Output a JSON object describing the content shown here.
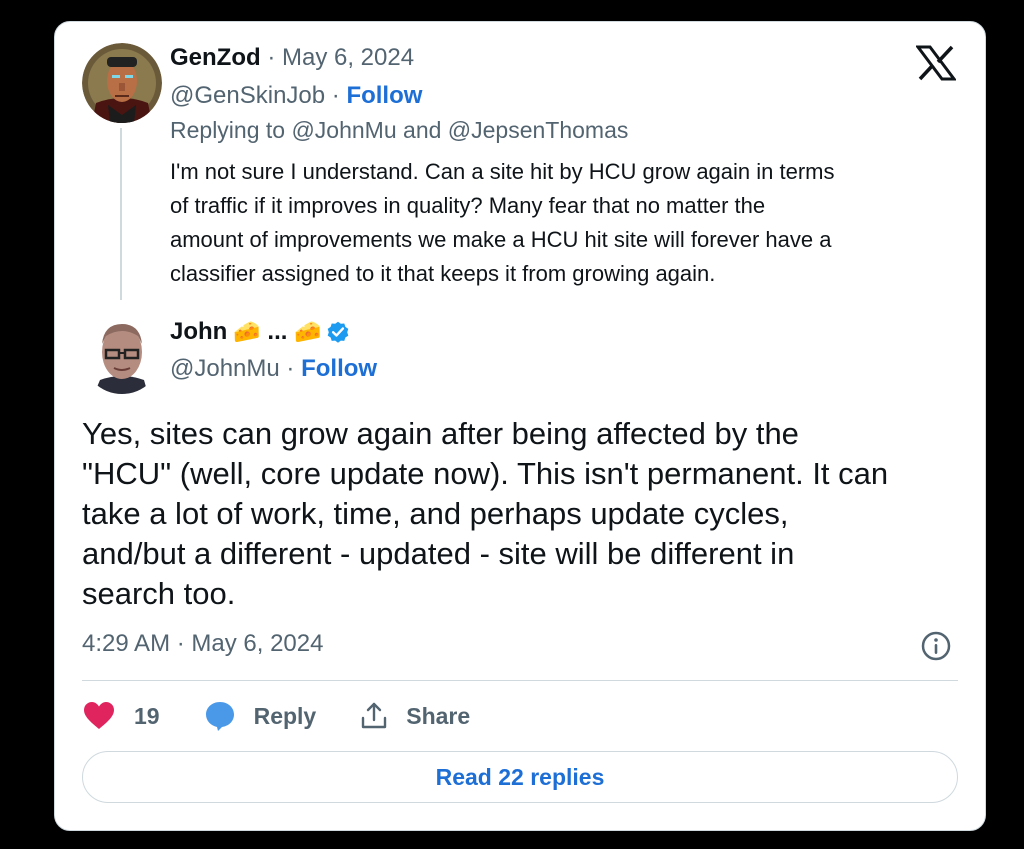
{
  "reply_tweet": {
    "author_name": "GenZod",
    "separator": " · ",
    "date": "May 6, 2024",
    "handle": "@GenSkinJob",
    "follow_label": "Follow",
    "replying_to": "Replying to @JohnMu and @JepsenThomas",
    "body_lines": [
      "I'm not sure I understand. Can a site hit by HCU grow again in terms",
      "of traffic if it improves in quality? Many  fear that no matter the",
      "amount of improvements we make a HCU hit site will forever have a",
      "classifier assigned to it that keeps it from growing again."
    ]
  },
  "main_tweet": {
    "author_name": "John",
    "name_emoji_1": "🧀",
    "name_ellipsis": " ... ",
    "name_emoji_2": "🧀",
    "verified": true,
    "handle": "@JohnMu",
    "separator": " · ",
    "follow_label": "Follow",
    "body_lines": [
      "Yes, sites can grow again after being affected by the",
      "\"HCU\" (well, core update now). This isn't permanent. It can",
      "take a lot of work, time, and perhaps update cycles,",
      "and/but a different - updated - site will be different in",
      "search too."
    ],
    "timestamp": "4:29 AM · May 6, 2024"
  },
  "actions": {
    "like_count": "19",
    "reply_label": "Reply",
    "share_label": "Share"
  },
  "read_replies_label": "Read 22 replies",
  "icons": {
    "brand": "x-logo-icon",
    "info": "info-icon",
    "like": "heart-icon",
    "reply": "speech-bubble-icon",
    "share": "share-upload-icon",
    "verified": "verified-badge-icon"
  },
  "colors": {
    "text_primary": "#0f1419",
    "text_secondary": "#536471",
    "link_blue": "#1d6fd6",
    "heart_pink": "#e0245e",
    "reply_blue": "#4a99e9",
    "verified_blue": "#1d9bf0",
    "border": "#cfd9de"
  }
}
